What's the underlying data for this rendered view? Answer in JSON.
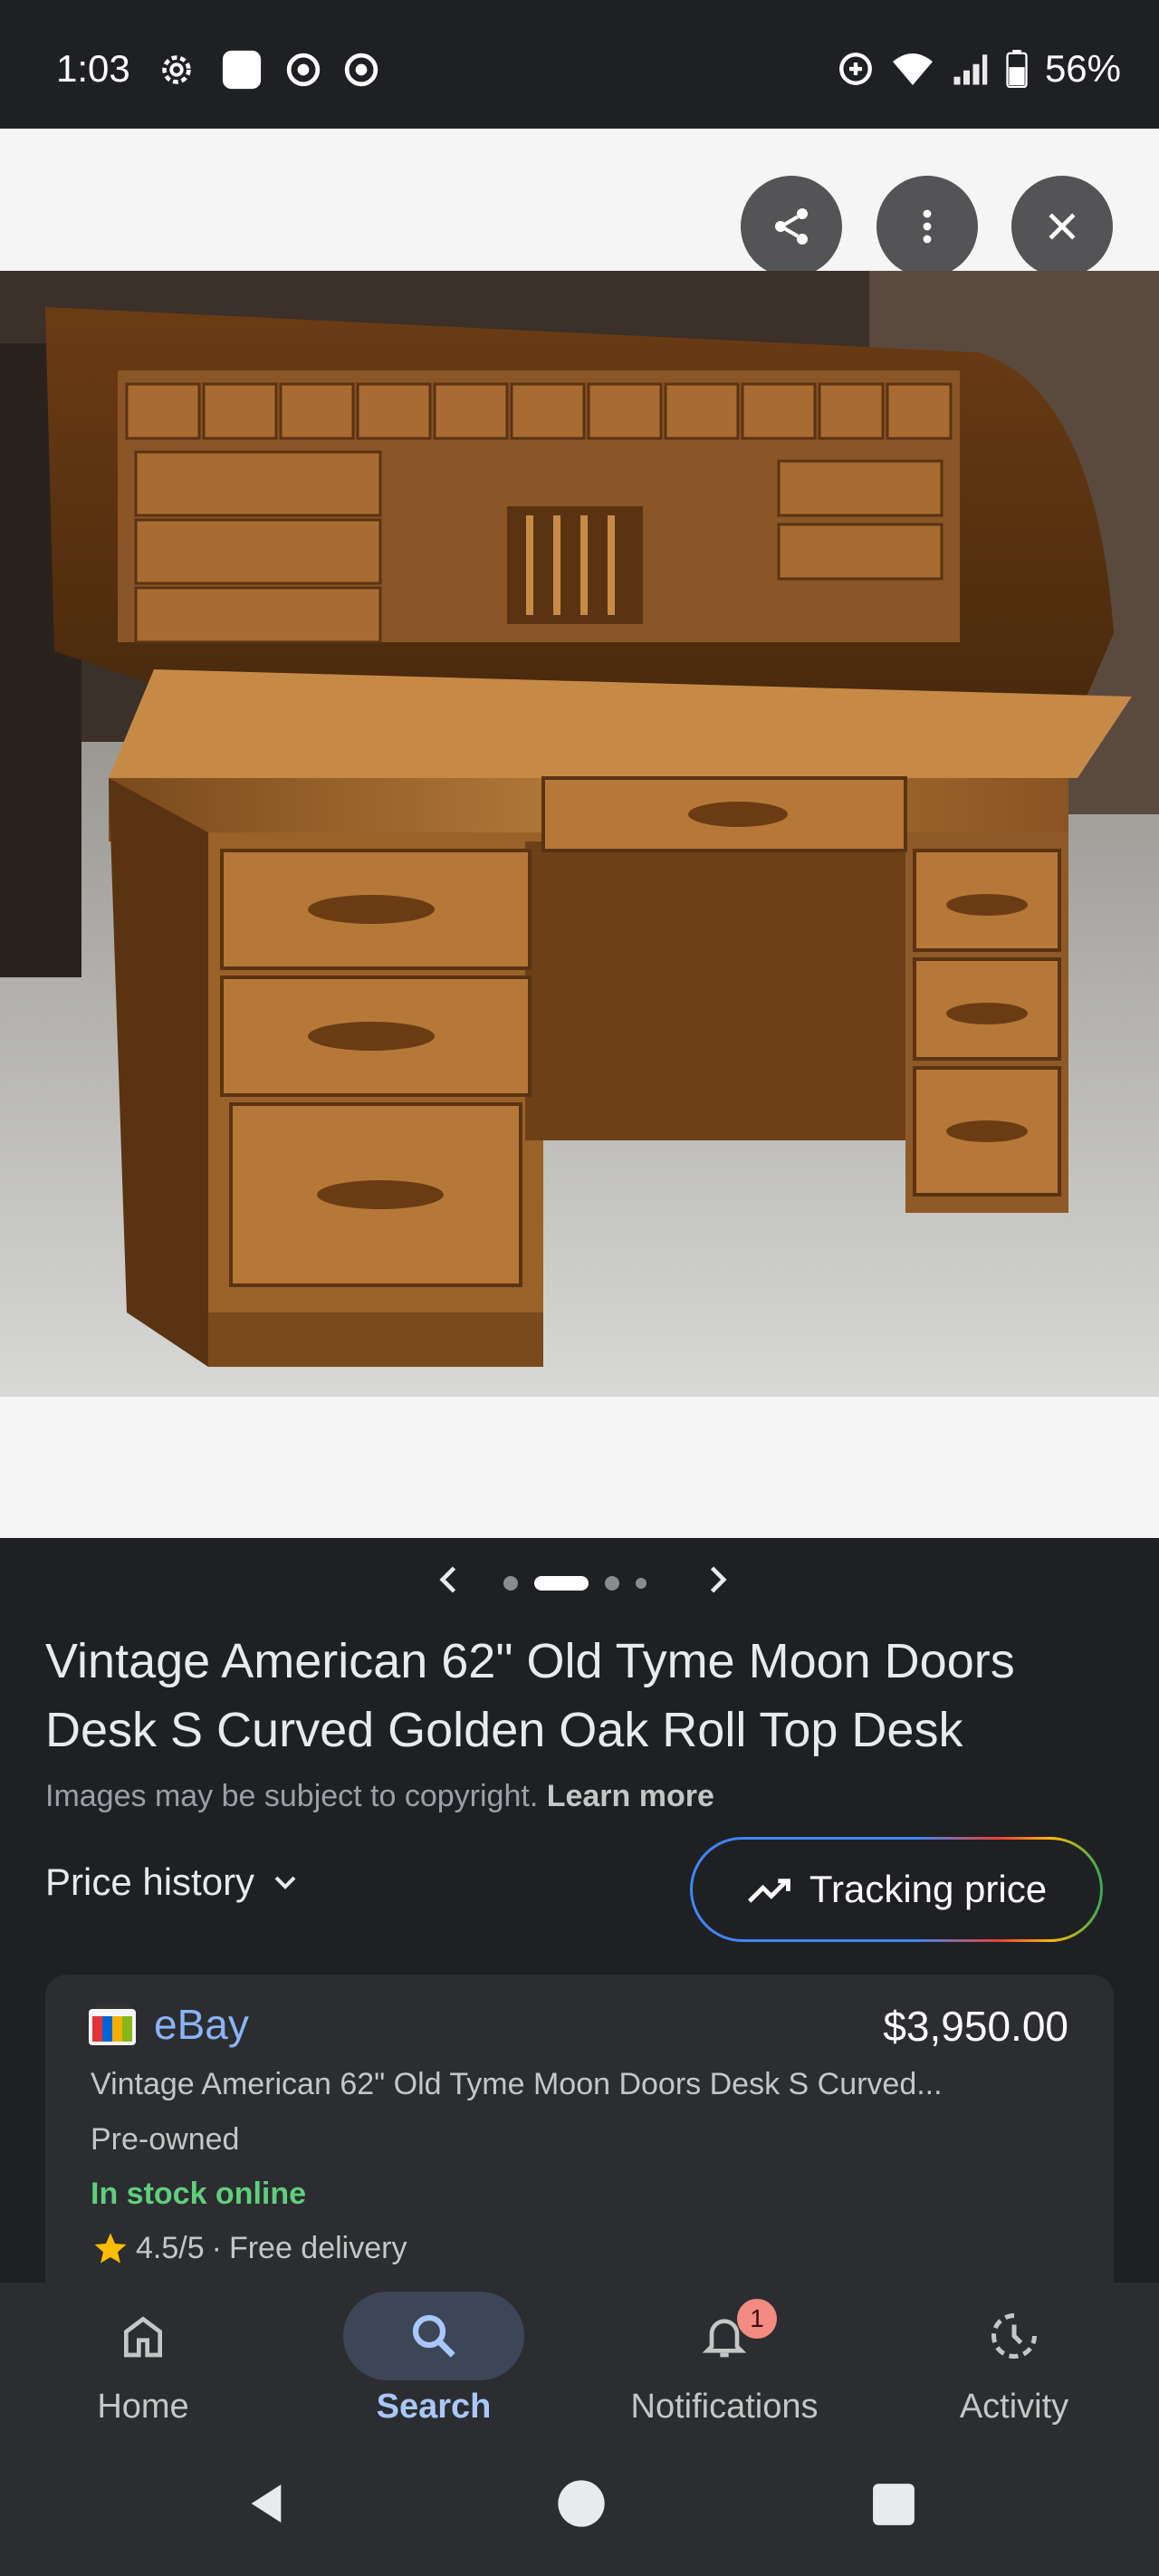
{
  "status_bar": {
    "time": "1:03",
    "battery": "56%",
    "left_icons": [
      "settings-icon",
      "app-icon",
      "chrome-icon",
      "chrome-icon"
    ],
    "right_icons": [
      "data-saver-icon",
      "wifi-icon",
      "signal-icon",
      "battery-icon"
    ]
  },
  "viewer": {
    "actions": [
      "share-icon",
      "more-vert-icon",
      "close-icon"
    ],
    "image_alt": "Golden oak roll top desk"
  },
  "carousel": {
    "dot_count": 4,
    "active_index": 1
  },
  "product": {
    "title": "Vintage American 62\" Old Tyme Moon Doors Desk S Curved Golden Oak Roll Top Desk",
    "copyright_text": "Images may be subject to copyright.",
    "learn_more": "Learn more",
    "price_history_label": "Price history",
    "tracking_label": "Tracking price"
  },
  "listing": {
    "store": "eBay",
    "price": "$3,950.00",
    "description": "Vintage American 62\" Old Tyme Moon Doors Desk S Curved...",
    "condition": "Pre-owned",
    "stock": "In stock online",
    "rating": "4.5/5",
    "delivery": "Free delivery",
    "separator": "·"
  },
  "bottom_nav": {
    "items": [
      {
        "label": "Home",
        "icon": "home-icon"
      },
      {
        "label": "Search",
        "icon": "search-icon",
        "active": true
      },
      {
        "label": "Notifications",
        "icon": "bell-icon",
        "badge": "1"
      },
      {
        "label": "Activity",
        "icon": "activity-icon"
      }
    ]
  },
  "colors": {
    "background": "#1f2023",
    "card": "#2c2d30",
    "accent_blue": "#8ab4f8",
    "active_nav": "#a8c7fa",
    "in_stock_green": "#5fcf7c",
    "badge": "#f28b82"
  }
}
